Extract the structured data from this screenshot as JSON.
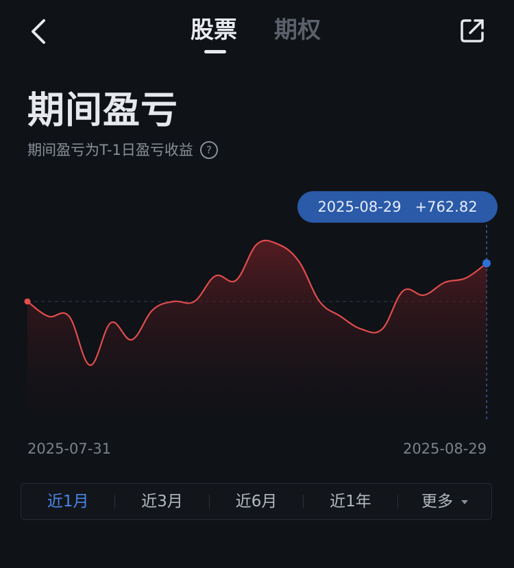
{
  "header": {
    "back_icon": "chevron-left-icon",
    "share_icon": "share-external-icon",
    "tabs": [
      {
        "label": "股票",
        "active": true
      },
      {
        "label": "期权",
        "active": false
      }
    ]
  },
  "page": {
    "title": "期间盈亏",
    "subtitle": "期间盈亏为T-1日盈亏收益",
    "help_icon": "question-circle-icon"
  },
  "tooltip": {
    "date": "2025-08-29",
    "value": "+762.82"
  },
  "chart_data": {
    "type": "area",
    "x_start": "2025-07-31",
    "x_end": "2025-08-29",
    "line_color": "#e24d4d",
    "highlight_color": "#2f6fd6",
    "y": [
      0,
      -70,
      -70,
      -300,
      -100,
      -180,
      -40,
      0,
      0,
      120,
      100,
      270,
      270,
      190,
      0,
      -70,
      -130,
      -130,
      50,
      30,
      90,
      110,
      180
    ],
    "highlight": {
      "x": "2025-08-29",
      "value": 762.82
    }
  },
  "axis": {
    "start_label": "2025-07-31",
    "end_label": "2025-08-29"
  },
  "ranges": {
    "items": [
      "近1月",
      "近3月",
      "近6月",
      "近1年"
    ],
    "more_label": "更多",
    "active_index": 0
  },
  "colors": {
    "background": "#0f1217",
    "accent": "#4a86e8",
    "loss_line": "#e24d4d"
  }
}
